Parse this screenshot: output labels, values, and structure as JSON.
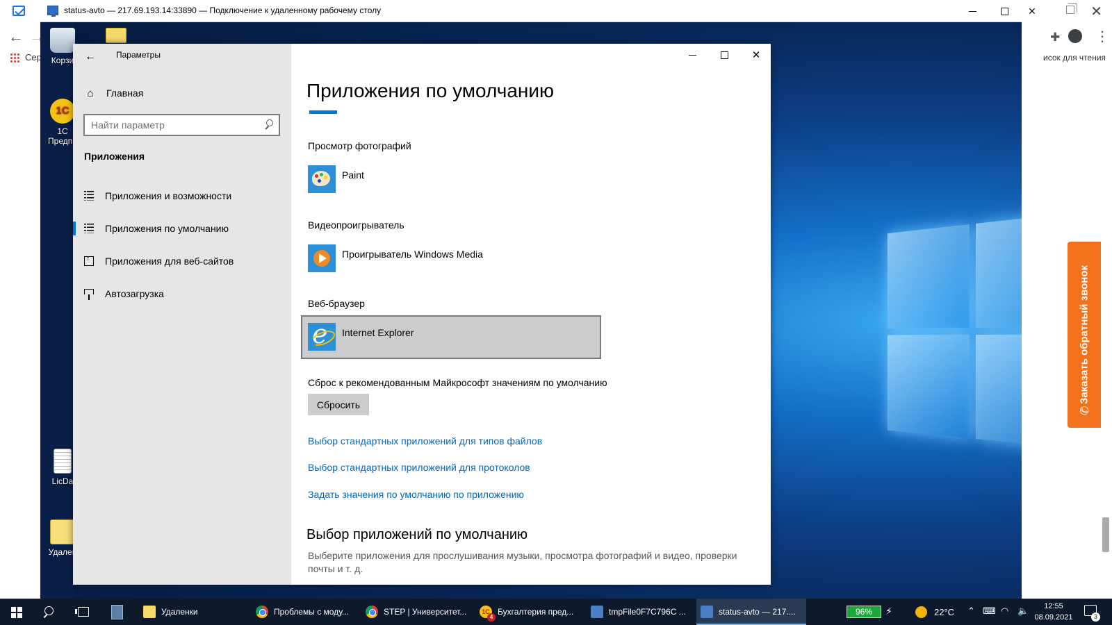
{
  "host": {
    "partial_bookmark": "Сер",
    "reading_list": "исок для чтения",
    "callback_label": "Заказать обратный звонок"
  },
  "rdp": {
    "title": "status-avto — 217.69.193.14:33890 — Подключение к удаленному рабочему столу"
  },
  "desktop": {
    "icons": [
      "Корзи",
      "1С Предпр",
      "LicDa",
      "Удален"
    ]
  },
  "settings": {
    "window_title": "Параметры",
    "home_label": "Главная",
    "search_placeholder": "Найти параметр",
    "section_label": "Приложения",
    "nav_items": [
      {
        "label": "Приложения и возможности",
        "icon": "apps-features-icon"
      },
      {
        "label": "Приложения по умолчанию",
        "icon": "default-apps-icon",
        "active": true
      },
      {
        "label": "Приложения для веб-сайтов",
        "icon": "apps-websites-icon"
      },
      {
        "label": "Автозагрузка",
        "icon": "startup-icon"
      }
    ],
    "page_title": "Приложения по умолчанию",
    "photo_viewer": {
      "label": "Просмотр фотографий",
      "app": "Paint"
    },
    "video_player": {
      "label": "Видеопроигрыватель",
      "app": "Проигрыватель Windows Media"
    },
    "web_browser": {
      "label": "Веб-браузер",
      "app": "Internet Explorer"
    },
    "reset": {
      "label": "Сброс к рекомендованным Майкрософт значениям по умолчанию",
      "button": "Сбросить"
    },
    "links": [
      "Выбор стандартных приложений для типов файлов",
      "Выбор стандартных приложений для протоколов",
      "Задать значения по умолчанию по приложению"
    ],
    "section_title": "Выбор приложений по умолчанию",
    "section_desc": "Выберите приложения для прослушивания музыки, просмотра фотографий и видео, проверки почты и т. д."
  },
  "taskbar": {
    "apps": [
      {
        "label": "Удаленки",
        "icon": "folder-icon"
      },
      {
        "label": "Проблемы с моду...",
        "icon": "chrome-icon"
      },
      {
        "label": "STEP | Университет...",
        "icon": "chrome-icon"
      },
      {
        "label": "Бухгалтерия пред...",
        "icon": "1c-icon",
        "badge": "4"
      },
      {
        "label": "tmpFile0F7C796C ...",
        "icon": "rdp-icon"
      },
      {
        "label": "status-avto — 217....",
        "icon": "rdp-icon",
        "active": true
      }
    ],
    "battery": "96%",
    "temperature": "22°C",
    "time": "12:55",
    "date": "08.09.2021",
    "notifications": "3"
  }
}
